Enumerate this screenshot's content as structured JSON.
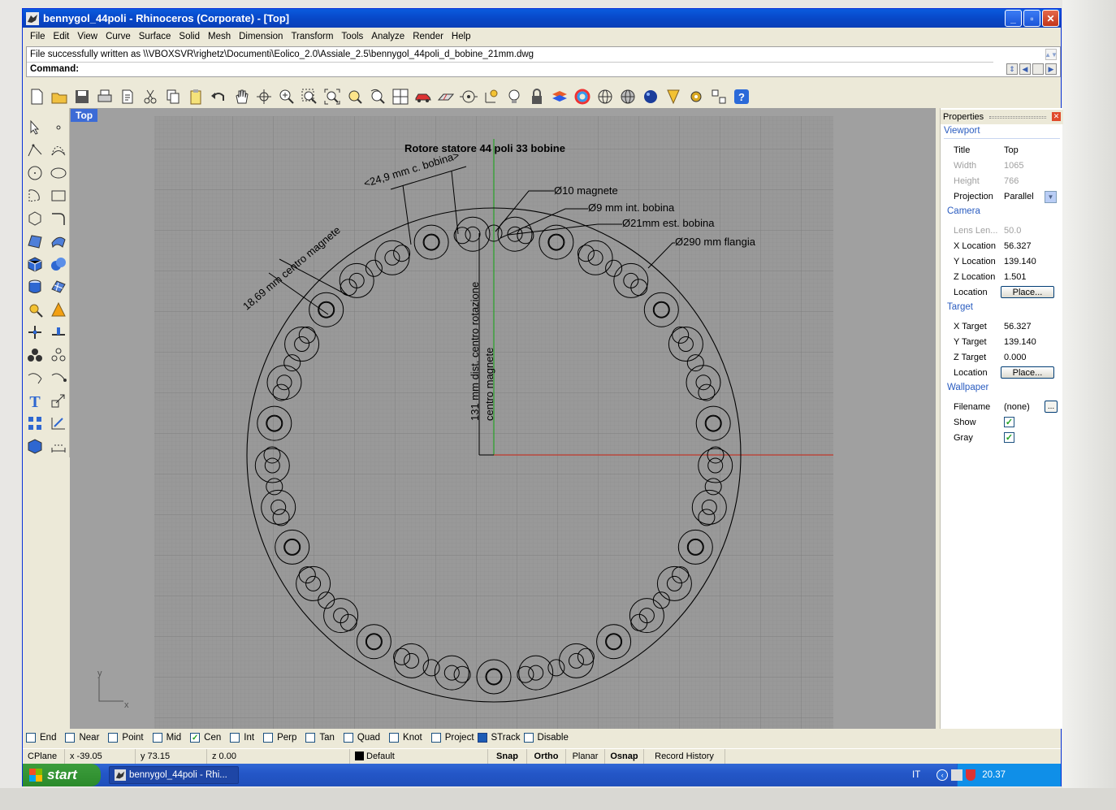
{
  "window": {
    "title": "bennygol_44poli - Rhinoceros (Corporate) - [Top]",
    "buttons": [
      "_",
      "▫",
      "✕"
    ]
  },
  "menu": [
    "File",
    "Edit",
    "View",
    "Curve",
    "Surface",
    "Solid",
    "Mesh",
    "Dimension",
    "Transform",
    "Tools",
    "Analyze",
    "Render",
    "Help"
  ],
  "command": {
    "history": "File successfully written as \\\\VBOXSVR\\righetz\\Documenti\\Eolico_2.0\\Assiale_2.5\\bennygol_44poli_d_bobine_21mm.dwg",
    "prompt": "Command:"
  },
  "viewport": {
    "tab": "Top",
    "drawing_title": "Rotore statore 44 poli 33 bobine",
    "annotations": {
      "magnet": "Ø10 magnete",
      "coil_inner": "Ø9 mm int. bobina",
      "coil_outer": "Ø21mm est. bobina",
      "flange": "Ø290 mm flangia",
      "coil_spacing": "<24,9 mm c. bobina>",
      "magnet_spacing": "18,69 mm centro magnete",
      "radius_1": "131 mm dist. centro rotazione",
      "radius_2": "centro magnete"
    },
    "axis_x": "x",
    "axis_y": "y"
  },
  "properties": {
    "title": "Properties",
    "viewport_section": "Viewport",
    "camera_section": "Camera",
    "target_section": "Target",
    "wallpaper_section": "Wallpaper",
    "rows": {
      "title": {
        "label": "Title",
        "value": "Top"
      },
      "width": {
        "label": "Width",
        "value": "1065"
      },
      "height": {
        "label": "Height",
        "value": "766"
      },
      "projection": {
        "label": "Projection",
        "value": "Parallel"
      },
      "lens": {
        "label": "Lens Len...",
        "value": "50.0"
      },
      "xloc": {
        "label": "X Location",
        "value": "56.327"
      },
      "yloc": {
        "label": "Y Location",
        "value": "139.140"
      },
      "zloc": {
        "label": "Z Location",
        "value": "1.501"
      },
      "cam_location": {
        "label": "Location",
        "button": "Place..."
      },
      "xtarget": {
        "label": "X Target",
        "value": "56.327"
      },
      "ytarget": {
        "label": "Y Target",
        "value": "139.140"
      },
      "ztarget": {
        "label": "Z Target",
        "value": "0.000"
      },
      "tgt_location": {
        "label": "Location",
        "button": "Place..."
      },
      "filename": {
        "label": "Filename",
        "value": "(none)",
        "button": "..."
      },
      "show": {
        "label": "Show"
      },
      "gray": {
        "label": "Gray"
      }
    }
  },
  "osnap": [
    {
      "label": "End",
      "checked": false
    },
    {
      "label": "Near",
      "checked": false
    },
    {
      "label": "Point",
      "checked": false
    },
    {
      "label": "Mid",
      "checked": false
    },
    {
      "label": "Cen",
      "checked": true
    },
    {
      "label": "Int",
      "checked": false
    },
    {
      "label": "Perp",
      "checked": false
    },
    {
      "label": "Tan",
      "checked": false
    },
    {
      "label": "Quad",
      "checked": false
    },
    {
      "label": "Knot",
      "checked": false
    },
    {
      "label": "Project",
      "checked": false
    },
    {
      "label": "STrack",
      "checked": false
    },
    {
      "label": "Disable",
      "checked": false
    }
  ],
  "status": {
    "cplane": "CPlane",
    "x": "x -39.05",
    "y": "y 73.15",
    "z": "z 0.00",
    "layer": "Default",
    "snap": "Snap",
    "ortho": "Ortho",
    "planar": "Planar",
    "osnap": "Osnap",
    "record": "Record History"
  },
  "taskbar": {
    "start": "start",
    "item": "bennygol_44poli - Rhi...",
    "lang": "IT",
    "time": "20.37"
  },
  "colors": {
    "titlebar": "#0a5bde",
    "viewport_bg": "#a0a0a0",
    "grid_paper": "#999999",
    "x_axis": "#c0392b",
    "y_axis": "#27a327",
    "section_header": "#2a5cc0"
  }
}
